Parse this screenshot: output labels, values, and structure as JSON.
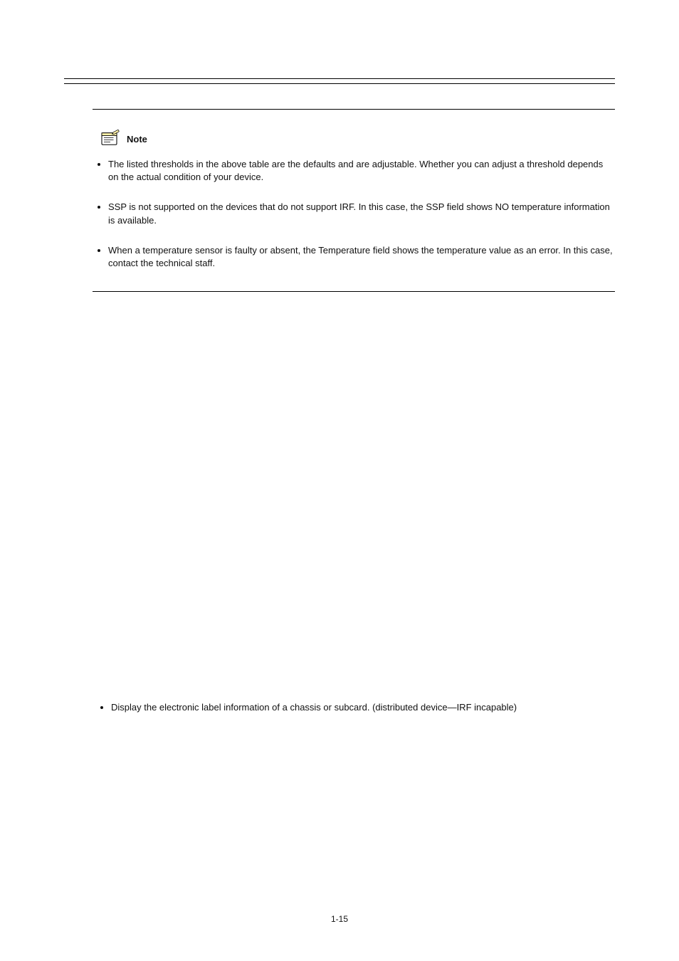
{
  "page": {
    "number": "1-15"
  },
  "note": {
    "label": "Note",
    "items": [
      "The listed thresholds in the above table are the defaults and are adjustable. Whether you can adjust a threshold depends on the actual condition of your device.",
      "SSP is not supported on the devices that do not support IRF. In this case, the SSP field shows NO temperature information is available.",
      "When a temperature sensor is faulty or absent, the Temperature field shows the temperature value as an error. In this case, contact the technical staff."
    ]
  },
  "standalone_bullet": "Display the electronic label information of a chassis or subcard. (distributed device—IRF incapable)"
}
